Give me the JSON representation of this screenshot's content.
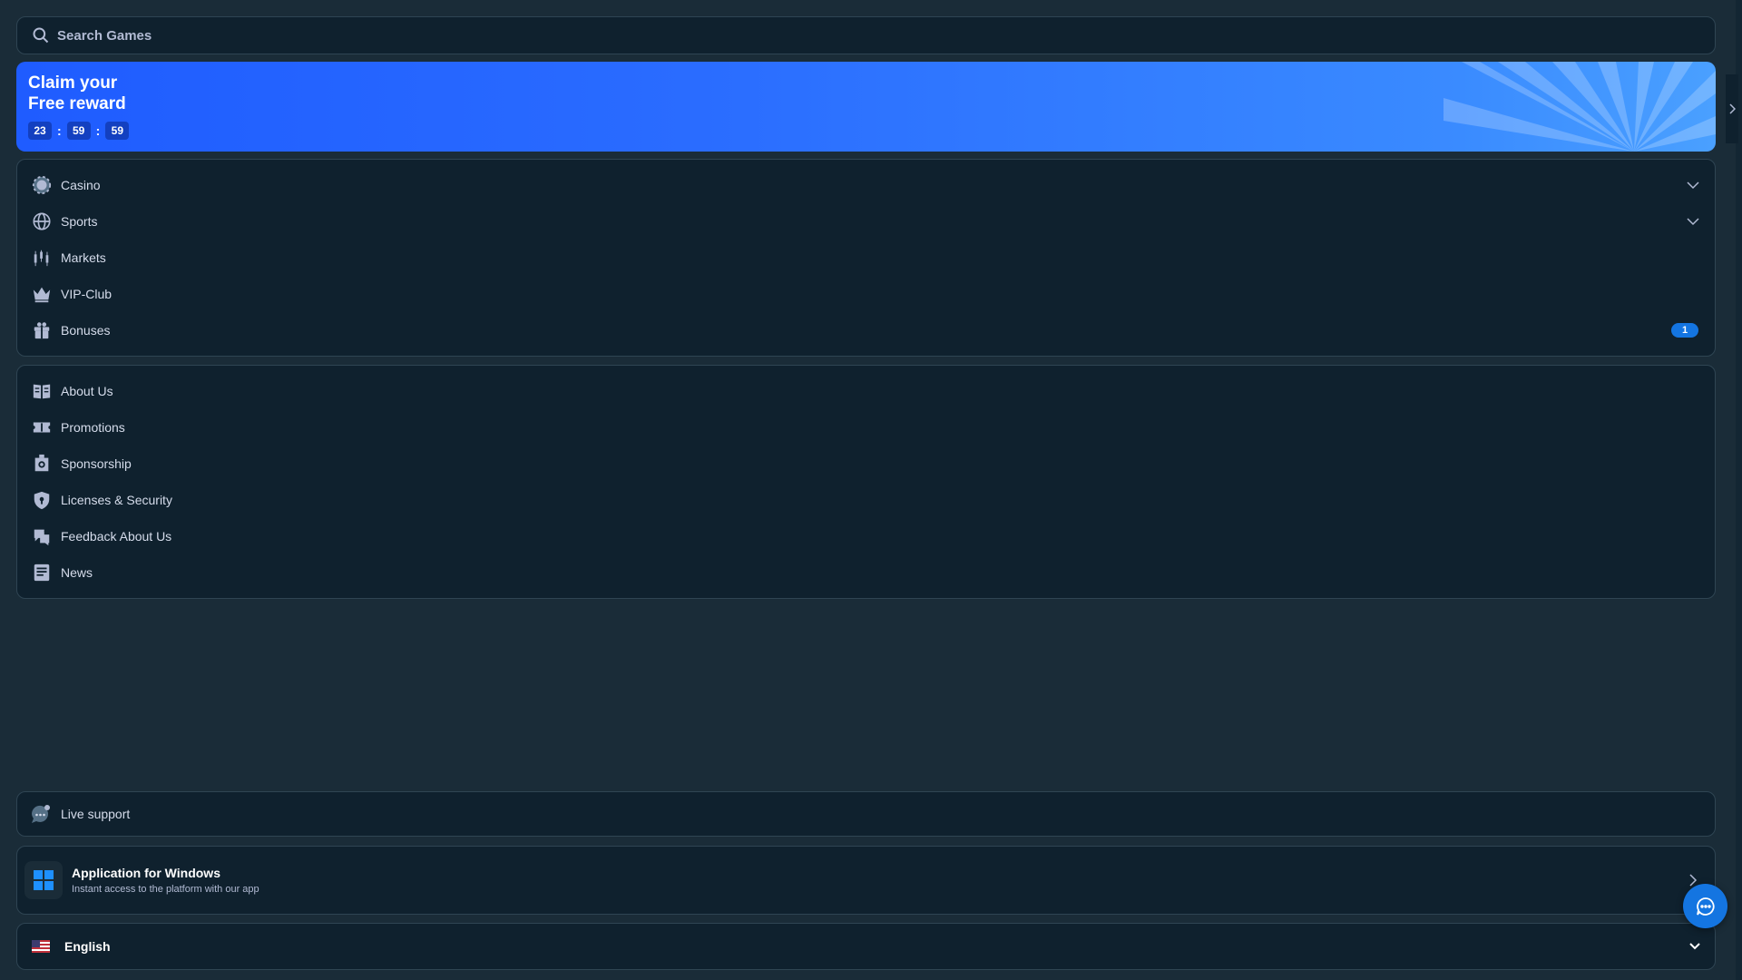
{
  "search": {
    "placeholder": "Search Games"
  },
  "banner": {
    "title_line1": "Claim your",
    "title_line2": "Free reward",
    "timer": {
      "hours": "23",
      "minutes": "59",
      "seconds": "59",
      "separator": ":"
    }
  },
  "main_menu": {
    "items": [
      {
        "label": "Casino",
        "icon": "casino-chip-icon",
        "expandable": true
      },
      {
        "label": "Sports",
        "icon": "globe-ball-icon",
        "expandable": true
      },
      {
        "label": "Markets",
        "icon": "candlestick-icon"
      },
      {
        "label": "VIP-Club",
        "icon": "crown-icon"
      },
      {
        "label": "Bonuses",
        "icon": "gift-icon",
        "badge": "1"
      }
    ]
  },
  "info_menu": {
    "items": [
      {
        "label": "About Us",
        "icon": "book-icon"
      },
      {
        "label": "Promotions",
        "icon": "ticket-icon"
      },
      {
        "label": "Sponsorship",
        "icon": "medal-icon"
      },
      {
        "label": "Licenses & Security",
        "icon": "shield-icon"
      },
      {
        "label": "Feedback About Us",
        "icon": "feedback-icon"
      },
      {
        "label": "News",
        "icon": "newspaper-icon"
      }
    ]
  },
  "live_support": {
    "label": "Live support"
  },
  "app_promo": {
    "title": "Application for Windows",
    "subtitle": "Instant access to the platform with our app"
  },
  "language": {
    "label": "English"
  },
  "colors": {
    "background": "#1a2c38",
    "panel": "#0f212e",
    "border": "#2f4553",
    "accent": "#1475e1",
    "banner": "#2a6cff"
  }
}
